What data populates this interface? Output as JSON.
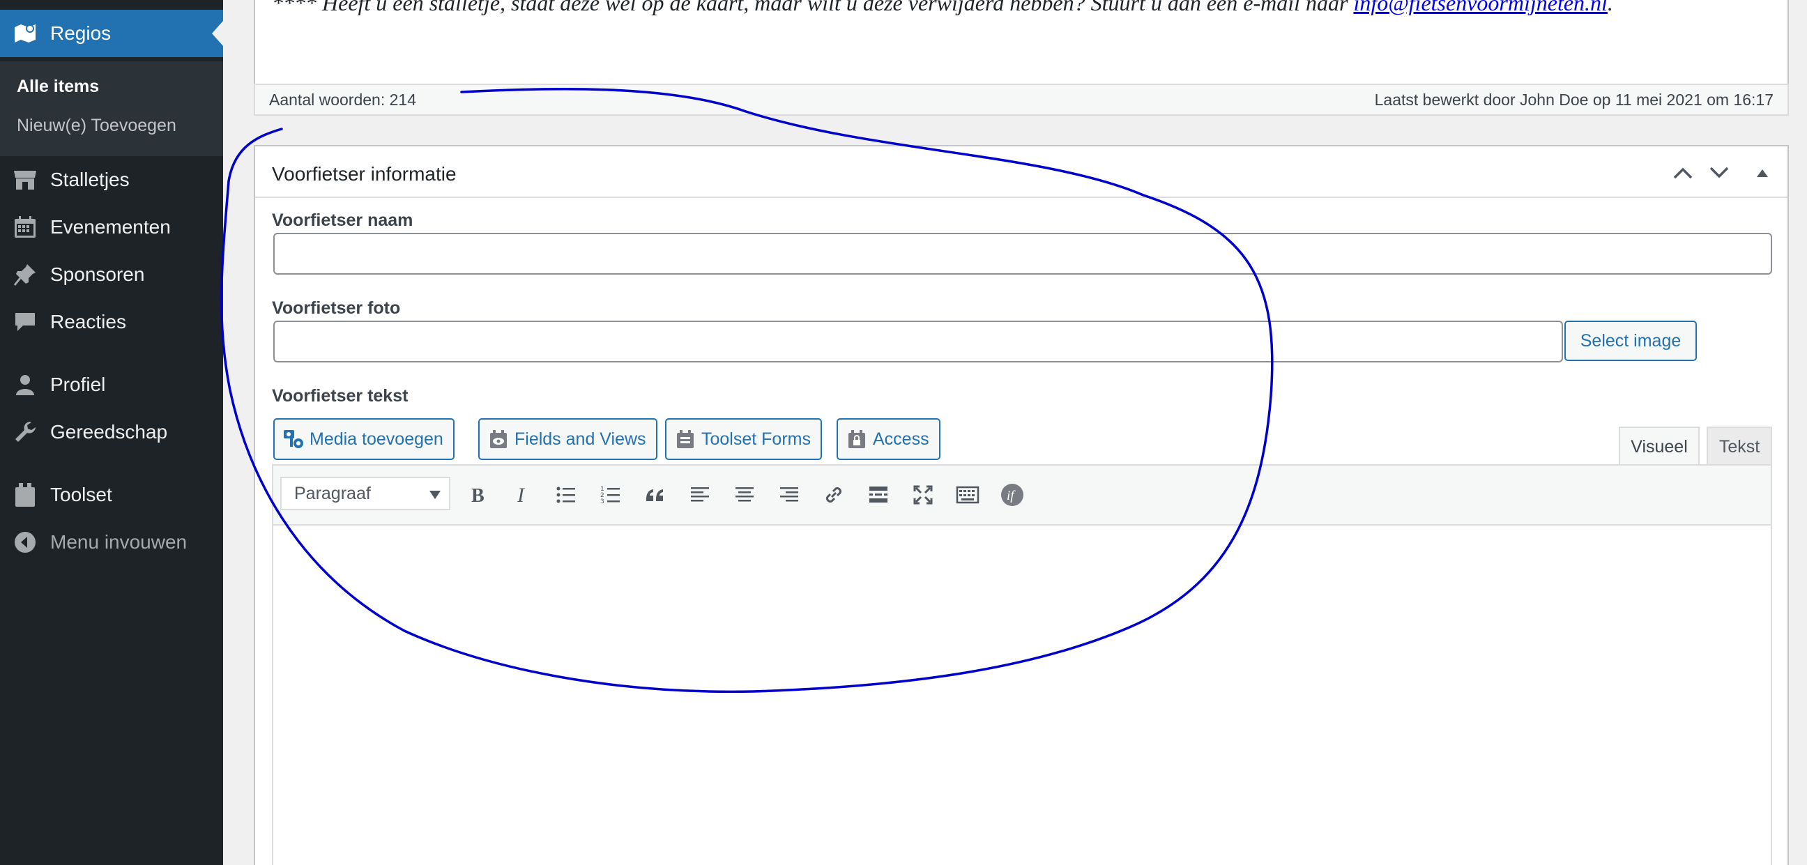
{
  "sidebar": {
    "current_item": "Regios",
    "submenu": [
      "Alle items",
      "Nieuw(e) Toevoegen"
    ],
    "items": [
      "Stalletjes",
      "Evenementen",
      "Sponsoren",
      "Reacties",
      "Profiel",
      "Gereedschap",
      "Toolset"
    ],
    "collapse_label": "Menu invouwen"
  },
  "editor_top": {
    "quote_prefix": "**** Heeft u een stalletje, staat deze wel op de kaart, maar wilt u deze verwijderd hebben? Stuurt u dan een e-mail naar ",
    "quote_link": "info@fietsenvoormijneten.nl",
    "quote_suffix": "."
  },
  "status_bar": {
    "word_count": "Aantal woorden: 214",
    "last_edited": "Laatst bewerkt door John Doe op 11 mei 2021 om 16:17"
  },
  "metabox": {
    "title": "Voorfietser informatie",
    "fields": {
      "name_label": "Voorfietser naam",
      "photo_label": "Voorfietser foto",
      "select_image": "Select image",
      "text_label": "Voorfietser tekst"
    },
    "toolbar_buttons": [
      "Media toevoegen",
      "Fields and Views",
      "Toolset Forms",
      "Access"
    ],
    "tabs": [
      "Visueel",
      "Tekst"
    ],
    "format_select": "Paragraaf",
    "mce_icons": [
      "bold-icon",
      "italic-icon",
      "bullet-list-icon",
      "numbered-list-icon",
      "blockquote-icon",
      "align-left-icon",
      "align-center-icon",
      "align-right-icon",
      "link-icon",
      "read-more-icon",
      "fullscreen-icon",
      "toolbar-toggle-icon",
      "conditional-if-icon"
    ]
  },
  "colors": {
    "sidebar_bg": "#1d2327",
    "accent": "#2271b1",
    "annotation": "#0000cc"
  }
}
